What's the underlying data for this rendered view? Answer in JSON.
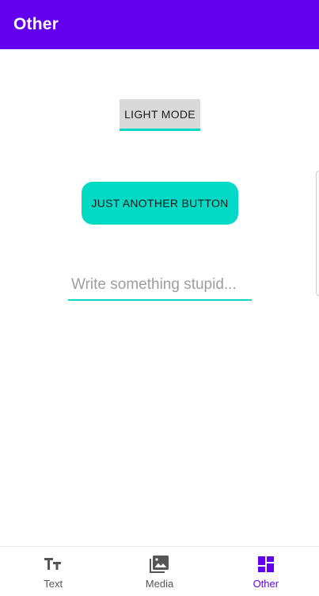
{
  "app_bar": {
    "title": "Other"
  },
  "main": {
    "toggle_button_label": "LIGHT MODE",
    "action_button_label": "JUST ANOTHER BUTTON",
    "input_placeholder": "Write something stupid...",
    "input_value": ""
  },
  "bottom_nav": {
    "items": [
      {
        "label": "Text",
        "icon": "text-format-icon",
        "active": false
      },
      {
        "label": "Media",
        "icon": "photo-library-icon",
        "active": false
      },
      {
        "label": "Other",
        "icon": "dashboard-icon",
        "active": true
      }
    ]
  },
  "colors": {
    "primary": "#6200EE",
    "accent": "#03DAC5",
    "toggle_background": "#D9D9D9",
    "inactive_nav": "#555555"
  }
}
